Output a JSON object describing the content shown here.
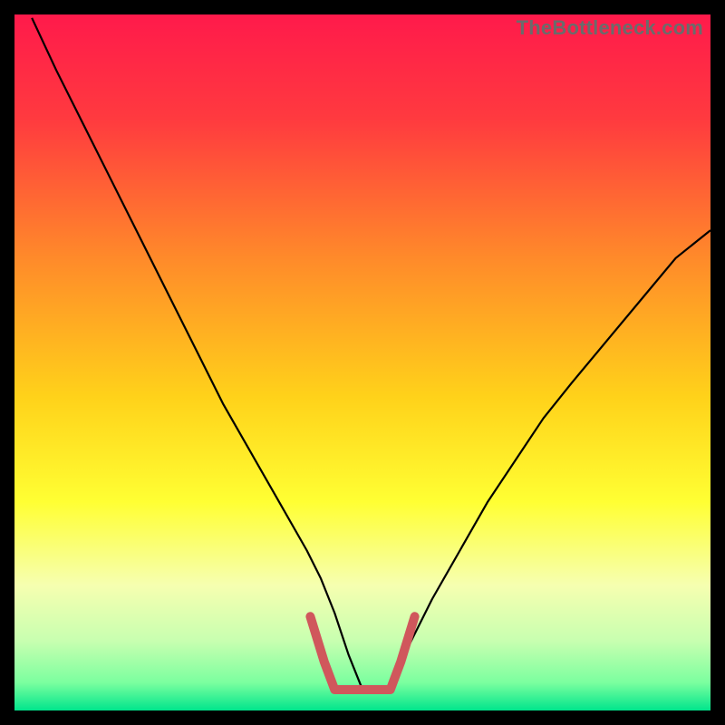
{
  "watermark": "TheBottleneck.com",
  "chart_data": {
    "type": "line",
    "title": "",
    "xlabel": "",
    "ylabel": "",
    "xlim": [
      0,
      100
    ],
    "ylim": [
      0,
      100
    ],
    "background_gradient": {
      "stops": [
        {
          "offset": 0.0,
          "color": "#ff1a4b"
        },
        {
          "offset": 0.15,
          "color": "#ff3a3f"
        },
        {
          "offset": 0.35,
          "color": "#ff8a2a"
        },
        {
          "offset": 0.55,
          "color": "#ffd21a"
        },
        {
          "offset": 0.7,
          "color": "#ffff33"
        },
        {
          "offset": 0.82,
          "color": "#f6ffb0"
        },
        {
          "offset": 0.9,
          "color": "#c8ffb0"
        },
        {
          "offset": 0.96,
          "color": "#7bff9f"
        },
        {
          "offset": 1.0,
          "color": "#00e58c"
        }
      ]
    },
    "series": [
      {
        "name": "bottleneck-curve",
        "stroke": "#000000",
        "stroke_width": 2.2,
        "x": [
          2.5,
          6,
          10,
          14,
          18,
          22,
          26,
          30,
          34,
          38,
          42,
          44,
          46,
          48,
          50,
          52,
          54,
          56,
          60,
          64,
          68,
          72,
          76,
          80,
          85,
          90,
          95,
          100
        ],
        "y": [
          99.5,
          92,
          84,
          76,
          68,
          60,
          52,
          44,
          37,
          30,
          23,
          19,
          14,
          8,
          3,
          3,
          3,
          8,
          16,
          23,
          30,
          36,
          42,
          47,
          53,
          59,
          65,
          69
        ]
      },
      {
        "name": "optimal-zone-marker",
        "stroke": "#d0575c",
        "stroke_width": 10,
        "linecap": "round",
        "x": [
          42.5,
          44.5,
          46,
          48,
          50,
          52,
          54,
          55.5,
          57.5
        ],
        "y": [
          13.5,
          7,
          3,
          3,
          3,
          3,
          3,
          7,
          13.5
        ]
      }
    ]
  }
}
